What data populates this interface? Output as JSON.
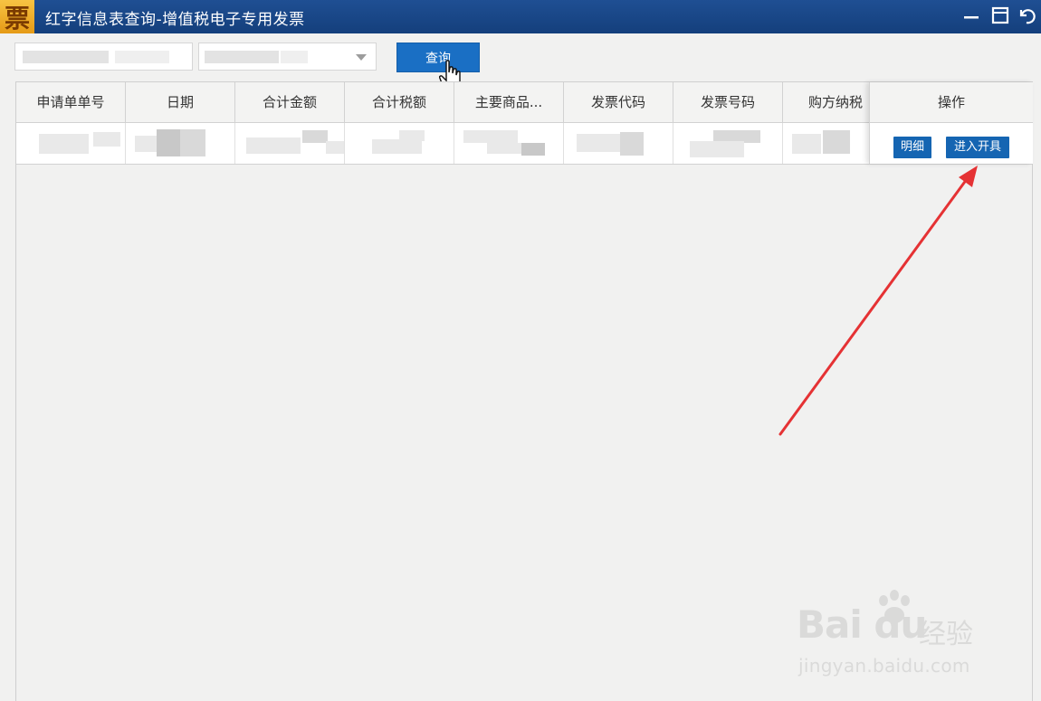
{
  "window": {
    "logo_char": "票",
    "title": "红字信息表查询-增值税电子专用发票",
    "controls": [
      "minimize-icon",
      "maximize-icon",
      "back-icon"
    ]
  },
  "filters": {
    "query_button": "查询"
  },
  "table": {
    "columns": [
      "申请单单号",
      "日期",
      "合计金额",
      "合计税额",
      "主要商品...",
      "发票代码",
      "发票号码",
      "购方纳税"
    ],
    "operations_header": "操作",
    "row_actions": {
      "detail": "明细",
      "open_invoice": "进入开具"
    }
  },
  "annotation": {
    "arrow_color": "#e53234"
  },
  "watermark": {
    "logo": "Bai du",
    "brand": "经验",
    "url": "jingyan.baidu.com"
  }
}
